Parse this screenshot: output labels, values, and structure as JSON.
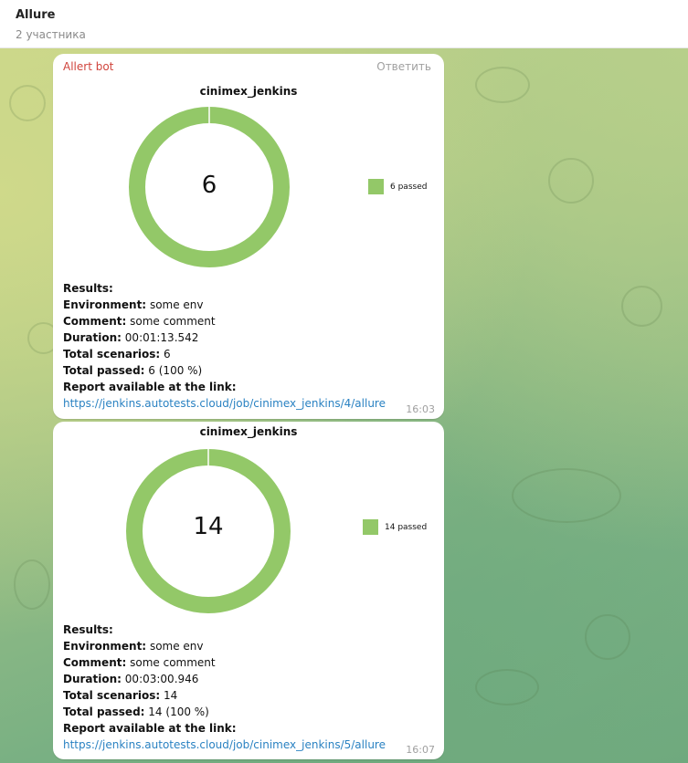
{
  "header": {
    "title": "Allure",
    "subtitle": "2 участника"
  },
  "colors": {
    "passed": "#93c868",
    "sender": "#d0443c",
    "link": "#2a82c2"
  },
  "messages": [
    {
      "sender": "Allert bot",
      "reply_label": "Ответить",
      "chart_title": "cinimex_jenkins",
      "center_value": "6",
      "legend_label": "6 passed",
      "results_label": "Results:",
      "environment_label": "Environment:",
      "environment": "some env",
      "comment_label": "Comment:",
      "comment": "some comment",
      "duration_label": "Duration:",
      "duration": "00:01:13.542",
      "total_scenarios_label": "Total scenarios:",
      "total_scenarios": "6",
      "total_passed_label": "Total passed:",
      "total_passed": "6 (100 %)",
      "report_label": "Report available at the link:",
      "link": "https://jenkins.autotests.cloud/job/cinimex_jenkins/4/allure",
      "time": "16:03"
    },
    {
      "chart_title": "cinimex_jenkins",
      "center_value": "14",
      "legend_label": "14 passed",
      "results_label": "Results:",
      "environment_label": "Environment:",
      "environment": "some env",
      "comment_label": "Comment:",
      "comment": "some comment",
      "duration_label": "Duration:",
      "duration": "00:03:00.946",
      "total_scenarios_label": "Total scenarios:",
      "total_scenarios": "14",
      "total_passed_label": "Total passed:",
      "total_passed": "14 (100 %)",
      "report_label": "Report available at the link:",
      "link": "https://jenkins.autotests.cloud/job/cinimex_jenkins/5/allure",
      "time": "16:07"
    }
  ]
}
